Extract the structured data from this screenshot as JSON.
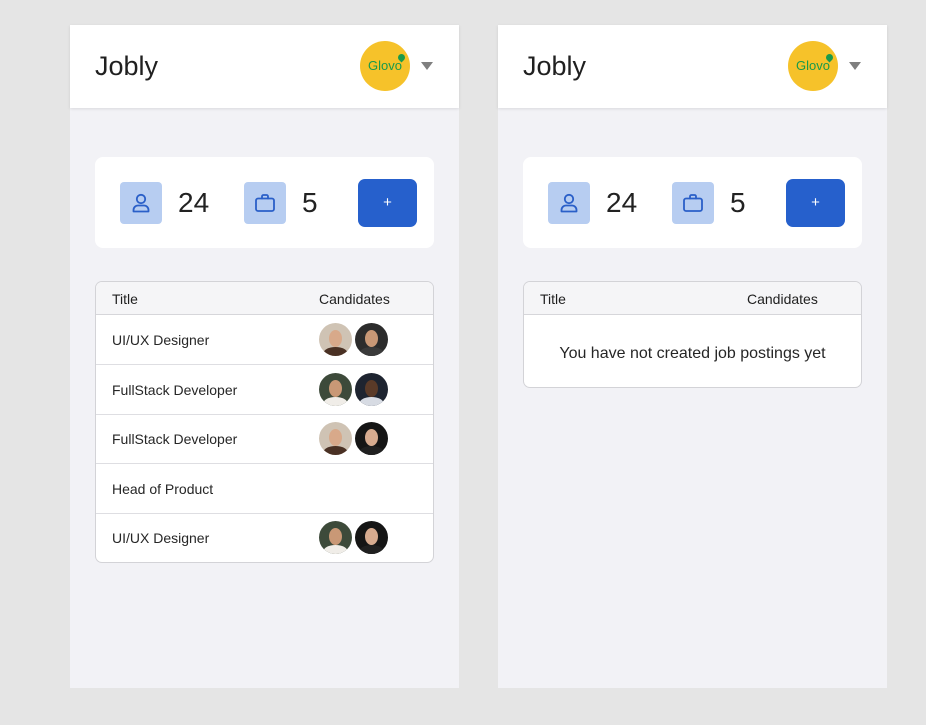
{
  "screens": [
    {
      "app_title": "Jobly",
      "company_logo_text": "Glovo",
      "stats": {
        "candidates": "24",
        "jobs": "5"
      },
      "add_button_label": "+",
      "table": {
        "headers": {
          "title": "Title",
          "candidates": "Candidates"
        },
        "rows": [
          {
            "title": "UI/UX Designer",
            "avatars": 2
          },
          {
            "title": "FullStack Developer",
            "avatars": 2
          },
          {
            "title": "FullStack Developer",
            "avatars": 2
          },
          {
            "title": "Head of Product",
            "avatars": 0
          },
          {
            "title": "UI/UX Designer",
            "avatars": 2
          }
        ]
      }
    },
    {
      "app_title": "Jobly",
      "company_logo_text": "Glovo",
      "stats": {
        "candidates": "24",
        "jobs": "5"
      },
      "add_button_label": "+",
      "table": {
        "headers": {
          "title": "Title",
          "candidates": "Candidates"
        },
        "empty_message": "You have not created job postings yet"
      }
    }
  ],
  "icons": {
    "candidates": "user-icon",
    "jobs": "briefcase-icon",
    "caret": "chevron-down-icon"
  },
  "colors": {
    "accent": "#2660cc",
    "icon_background": "#b7cdf1",
    "logo_background": "#f6c22a",
    "logo_text": "#1a9a4b",
    "page_background": "#f2f2f6"
  }
}
